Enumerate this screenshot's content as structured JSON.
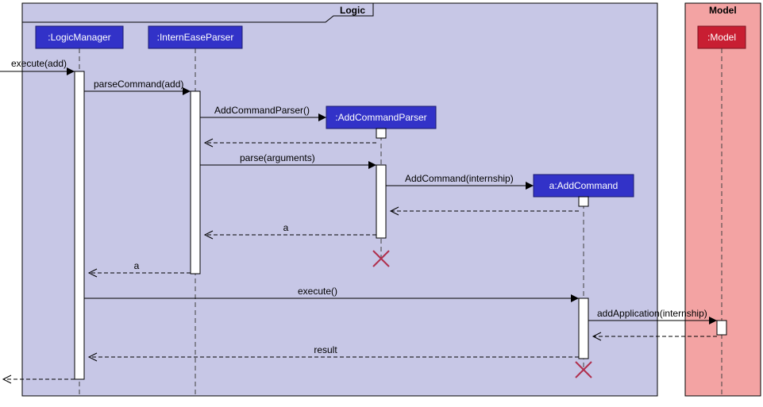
{
  "chart_data": {
    "type": "sequence_diagram",
    "frames": [
      {
        "name": "Logic",
        "participants": [
          ":LogicManager",
          ":InternEaseParser",
          ":AddCommandParser",
          "a:AddCommand"
        ],
        "color": "#C7C7E6"
      },
      {
        "name": "Model",
        "participants": [
          ":Model"
        ],
        "color": "#F3A3A3"
      }
    ],
    "actor_origin": "external",
    "participants": [
      {
        "id": "lm",
        "label": ":LogicManager",
        "frame": "Logic",
        "created_at_start": true
      },
      {
        "id": "iep",
        "label": ":InternEaseParser",
        "frame": "Logic",
        "created_at_start": true
      },
      {
        "id": "acp",
        "label": ":AddCommandParser",
        "frame": "Logic",
        "created_at_start": false
      },
      {
        "id": "ac",
        "label": "a:AddCommand",
        "frame": "Logic",
        "created_at_start": false
      },
      {
        "id": "model",
        "label": ":Model",
        "frame": "Model",
        "created_at_start": true
      }
    ],
    "messages": [
      {
        "from": "external",
        "to": "lm",
        "label": "execute(add)",
        "type": "call"
      },
      {
        "from": "lm",
        "to": "iep",
        "label": "parseCommand(add)",
        "type": "call"
      },
      {
        "from": "iep",
        "to": "acp",
        "label": "AddCommandParser()",
        "type": "create"
      },
      {
        "from": "acp",
        "to": "iep",
        "label": "",
        "type": "return"
      },
      {
        "from": "iep",
        "to": "acp",
        "label": "parse(arguments)",
        "type": "call"
      },
      {
        "from": "acp",
        "to": "ac",
        "label": "AddCommand(internship)",
        "type": "create"
      },
      {
        "from": "ac",
        "to": "acp",
        "label": "",
        "type": "return"
      },
      {
        "from": "acp",
        "to": "iep",
        "label": "a",
        "type": "return"
      },
      {
        "from": "acp",
        "to": null,
        "label": "",
        "type": "destroy"
      },
      {
        "from": "iep",
        "to": "lm",
        "label": "a",
        "type": "return"
      },
      {
        "from": "lm",
        "to": "ac",
        "label": "execute()",
        "type": "call"
      },
      {
        "from": "ac",
        "to": "model",
        "label": "addApplication(internship)",
        "type": "call"
      },
      {
        "from": "model",
        "to": "ac",
        "label": "",
        "type": "return"
      },
      {
        "from": "ac",
        "to": "lm",
        "label": "result",
        "type": "return"
      },
      {
        "from": "ac",
        "to": null,
        "label": "",
        "type": "destroy"
      },
      {
        "from": "lm",
        "to": "external",
        "label": "",
        "type": "return"
      }
    ]
  },
  "labels": {
    "frame_logic": "Logic",
    "frame_model": "Model",
    "p_lm": ":LogicManager",
    "p_iep": ":InternEaseParser",
    "p_acp": ":AddCommandParser",
    "p_ac": "a:AddCommand",
    "p_model": ":Model",
    "m_execute_add": "execute(add)",
    "m_parseCommand": "parseCommand(add)",
    "m_newACP": "AddCommandParser()",
    "m_parse_args": "parse(arguments)",
    "m_newAC": "AddCommand(internship)",
    "m_ret_a1": "a",
    "m_ret_a2": "a",
    "m_execute": "execute()",
    "m_addApp": "addApplication(internship)",
    "m_ret_result": "result"
  }
}
